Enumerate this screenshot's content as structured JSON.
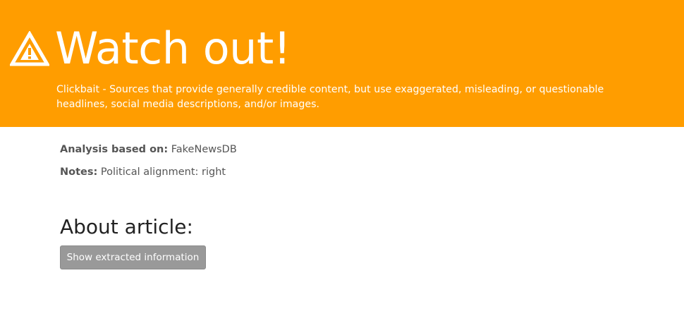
{
  "banner": {
    "icon": "warning-triangle-icon",
    "background_color": "#ff9d00",
    "headline": "Watch out!",
    "description": "Clickbait - Sources that provide generally credible content, but use exaggerated, misleading, or questionable headlines, social media descriptions, and/or images."
  },
  "analysis": {
    "source_label": "Analysis based on:",
    "source_value": "FakeNewsDB",
    "notes_label": "Notes:",
    "notes_value": "Political alignment: right"
  },
  "article": {
    "title": "About article:",
    "button_label": "Show extracted information"
  }
}
